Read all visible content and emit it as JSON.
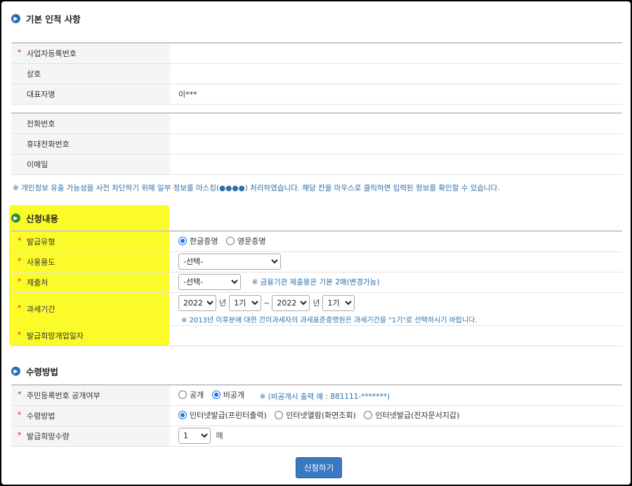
{
  "basic": {
    "title": "기본 인적 사항",
    "rows": [
      {
        "label": "사업자등록번호",
        "required": true,
        "value": ""
      },
      {
        "label": "상호",
        "required": false,
        "value": ""
      },
      {
        "label": "대표자명",
        "required": false,
        "value": "이***"
      }
    ],
    "contact_rows": [
      {
        "label": "전화번호",
        "value": ""
      },
      {
        "label": "휴대전화번호",
        "value": ""
      },
      {
        "label": "이메일",
        "value": ""
      }
    ],
    "privacy_note": "※ 개인정보 유출 가능성을 사전 차단하기 위해 일부 정보를 마스킹(●●●●) 처리하였습니다. 해당 칸을 마우스로 클릭하면 입력된 정보를 확인할 수 있습니다."
  },
  "application": {
    "title": "신청내용",
    "highlight_color": "#fbfb2a",
    "issue_type": {
      "label": "발급유형",
      "options": [
        "한글증명",
        "영문증명"
      ],
      "selected": "한글증명"
    },
    "purpose": {
      "label": "사용용도",
      "selected": "-선택-"
    },
    "submit_to": {
      "label": "제출처",
      "selected": "-선택-",
      "note": "※ 금융기관 제출용은 기본 2매(변경가능)"
    },
    "tax_period": {
      "label": "과세기간",
      "from_year": "2022",
      "from_period": "1기",
      "to_year": "2022",
      "to_period": "1기",
      "year_unit": "년",
      "separator": "~",
      "note": "※ 2013년 이후분에 대한 간이과세자의 과세표준증명원은 과세기간을 \"1기\"로 선택하시기 바랍니다."
    },
    "closure_date": {
      "label": "발급희망개업일자",
      "value": ""
    }
  },
  "receipt": {
    "title": "수령방법",
    "id_public": {
      "label": "주민등록번호 공개여부",
      "options": [
        "공개",
        "비공개"
      ],
      "selected": "비공개",
      "note": "※ (비공개시 출력 예 : 881111-*******)"
    },
    "method": {
      "label": "수령방법",
      "options": [
        "인터넷발급(프린터출력)",
        "인터넷열람(화면조회)",
        "인터넷발급(전자문서지갑)"
      ],
      "selected": "인터넷발급(프린터출력)"
    },
    "quantity": {
      "label": "발급희망수량",
      "selected": "1",
      "unit": "매"
    }
  },
  "submit_label": "신청하기"
}
